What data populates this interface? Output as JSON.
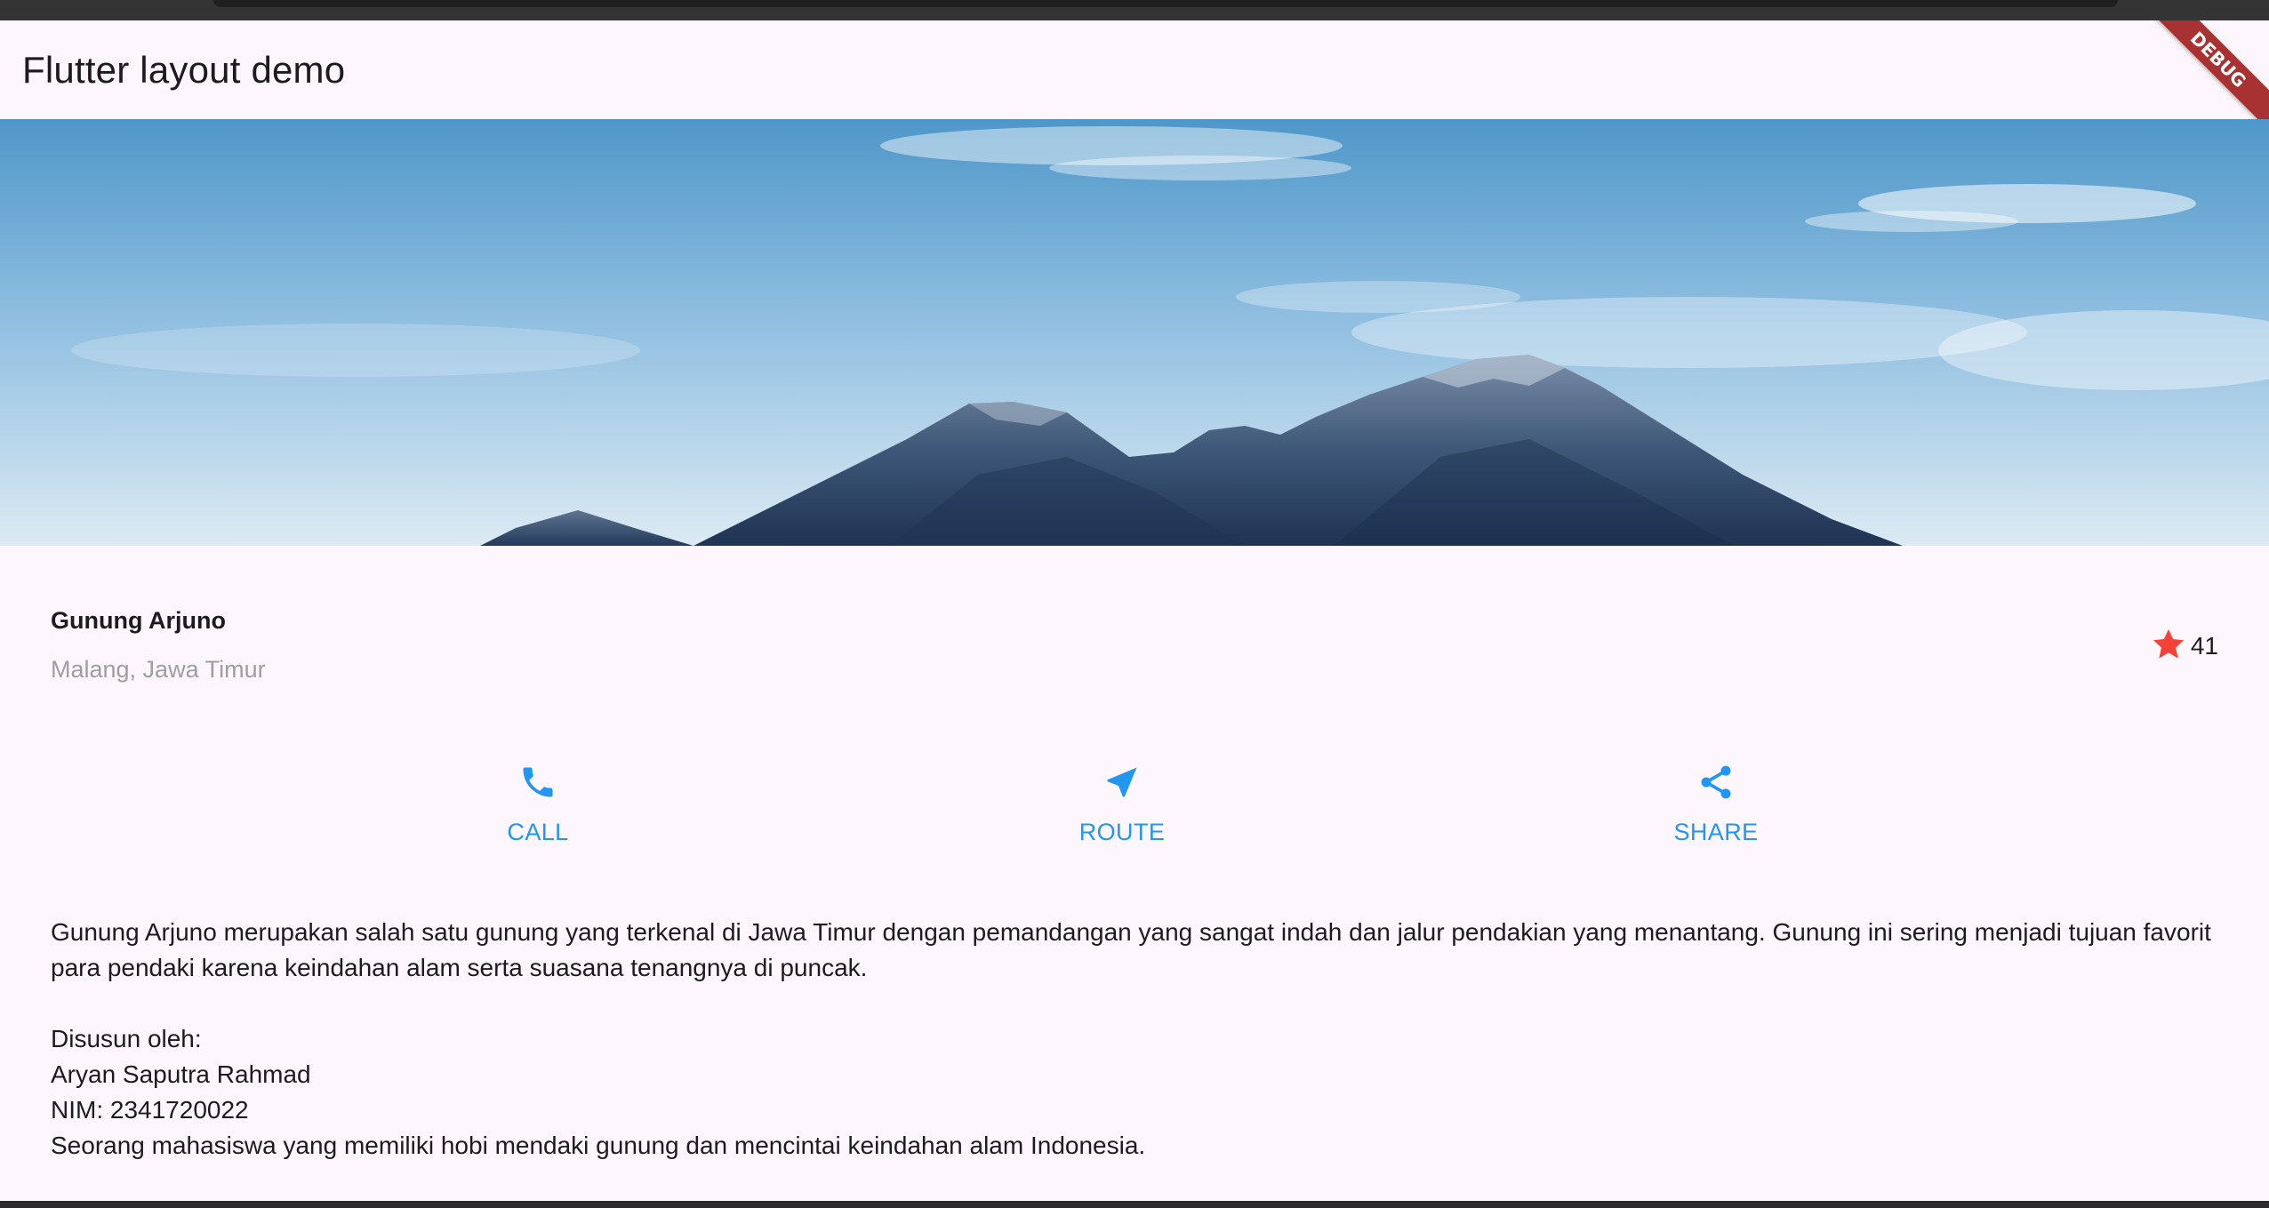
{
  "app_bar": {
    "title": "Flutter layout demo",
    "debug_banner": "DEBUG"
  },
  "hero_image": {
    "subject": "mountain-landscape"
  },
  "title_section": {
    "name": "Gunung Arjuno",
    "location": "Malang, Jawa Timur",
    "rating_count": "41",
    "rating_icon": "star-icon",
    "star_color": "#f44336"
  },
  "actions": {
    "call": {
      "label": "CALL",
      "icon": "phone-icon"
    },
    "route": {
      "label": "ROUTE",
      "icon": "navigation-icon"
    },
    "share": {
      "label": "SHARE",
      "icon": "share-icon"
    },
    "color": "#2196f3"
  },
  "description": {
    "text": "Gunung Arjuno merupakan salah satu gunung yang terkenal di Jawa Timur dengan pemandangan yang sangat indah dan jalur pendakian yang menantang. Gunung ini sering menjadi tujuan favorit para pendaki karena keindahan alam serta suasana tenangnya di puncak.\n\nDisusun oleh:\nAryan Saputra Rahmad\nNIM: 2341720022\nSeorang mahasiswa yang memiliki hobi mendaki gunung dan mencintai keindahan alam Indonesia."
  }
}
